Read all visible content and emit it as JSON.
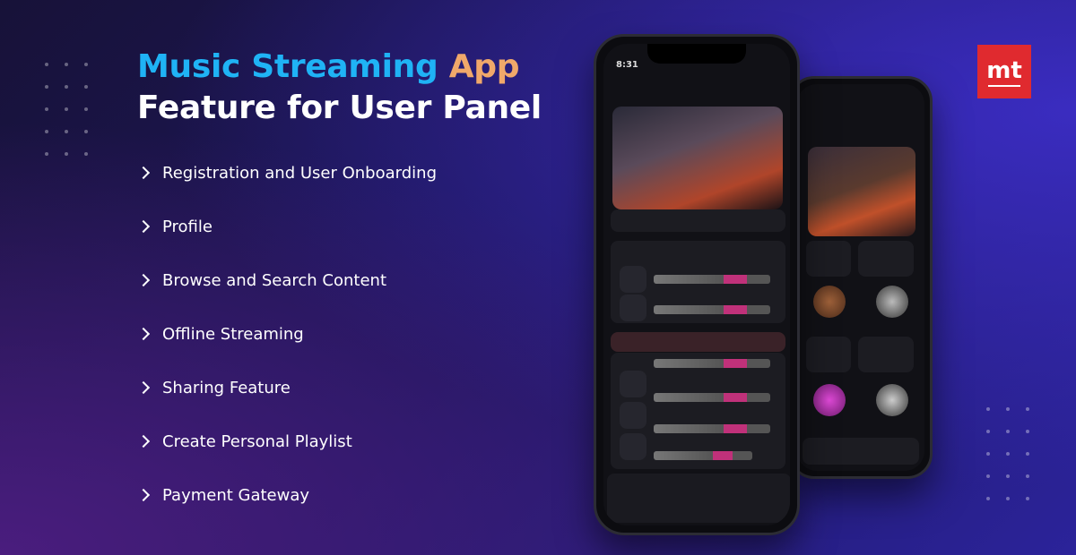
{
  "title": {
    "line1_part1": "Music Streaming",
    "line1_part2": "App",
    "line2": "Feature for User Panel"
  },
  "features": [
    "Registration and User Onboarding",
    "Profile",
    "Browse and Search Content",
    "Offline Streaming",
    "Sharing Feature",
    "Create Personal Playlist",
    "Payment Gateway"
  ],
  "logo": {
    "text": "mt",
    "color": "#e02a2f"
  },
  "phone": {
    "time": "8:31"
  },
  "colors": {
    "title_blue": "#1fb3f5",
    "title_orange": "#f0a86a",
    "accent_pink": "#c0317a"
  }
}
